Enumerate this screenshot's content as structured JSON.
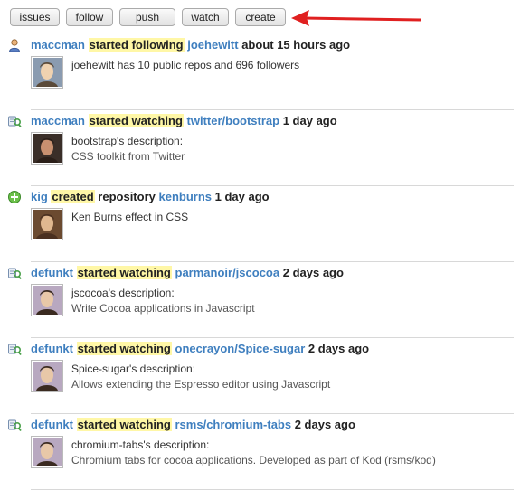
{
  "filters": [
    {
      "label": "issues",
      "enabled": false
    },
    {
      "label": "follow",
      "enabled": true
    },
    {
      "label": "push",
      "enabled": false
    },
    {
      "label": "watch",
      "enabled": true
    },
    {
      "label": "create",
      "enabled": true
    }
  ],
  "colors": {
    "link": "#3f7fbf",
    "highlight": "#fff7a6",
    "arrow": "#e02020"
  },
  "events": [
    {
      "icon": "follow-person-icon",
      "actor": "maccman",
      "action": "started following",
      "target": "joehewitt",
      "time": "about 15 hours ago",
      "line1": "joehewitt has 10 public repos and 696 followers",
      "line2": ""
    },
    {
      "icon": "watch-star-icon",
      "actor": "maccman",
      "action": "started watching",
      "target": "twitter/bootstrap",
      "time": "1 day ago",
      "line1": "bootstrap's description:",
      "line2": "CSS toolkit from Twitter"
    },
    {
      "icon": "create-plus-icon",
      "actor": "kig",
      "action": "created",
      "mid": "repository",
      "target": "kenburns",
      "time": "1 day ago",
      "line1": "Ken Burns effect in CSS",
      "line2": ""
    },
    {
      "icon": "watch-star-icon",
      "actor": "defunkt",
      "action": "started watching",
      "target": "parmanoir/jscocoa",
      "time": "2 days ago",
      "line1": "jscocoa's description:",
      "line2": "Write Cocoa applications in Javascript"
    },
    {
      "icon": "watch-star-icon",
      "actor": "defunkt",
      "action": "started watching",
      "target": "onecrayon/Spice-sugar",
      "time": "2 days ago",
      "line1": "Spice-sugar's description:",
      "line2": "Allows extending the Espresso editor using Javascript"
    },
    {
      "icon": "watch-star-icon",
      "actor": "defunkt",
      "action": "started watching",
      "target": "rsms/chromium-tabs",
      "time": "2 days ago",
      "line1": "chromium-tabs's description:",
      "line2": "Chromium tabs for cocoa applications. Developed as part of Kod (rsms/kod)"
    }
  ]
}
